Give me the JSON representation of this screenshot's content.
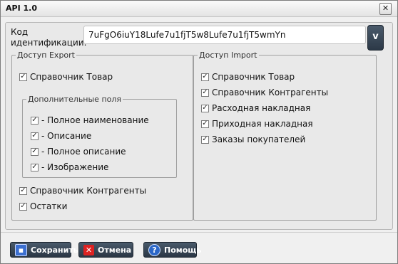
{
  "window": {
    "title": "API 1.0",
    "close_glyph": "✕"
  },
  "code": {
    "label_line1": "Код",
    "label_line2": "идентификации:",
    "value": "7uFgO6iuY18Lufe7u1fjT5w8Lufe7u1fjT5wmYn",
    "dropdown_label": "v"
  },
  "export": {
    "legend": "Доступ Export",
    "items": [
      {
        "label": "Справочник Товар",
        "checked": true
      },
      {
        "label": "Справочник Контрагенты",
        "checked": true
      },
      {
        "label": "Остатки",
        "checked": true
      }
    ],
    "extra": {
      "legend": "Дополнительные поля",
      "items": [
        {
          "label": "- Полное наименование",
          "checked": true
        },
        {
          "label": "- Описание",
          "checked": true
        },
        {
          "label": "- Полное описание",
          "checked": true
        },
        {
          "label": "- Изображение",
          "checked": true
        }
      ]
    }
  },
  "import": {
    "legend": "Доступ Import",
    "items": [
      {
        "label": "Справочник Товар",
        "checked": true
      },
      {
        "label": "Справочник Контрагенты",
        "checked": true
      },
      {
        "label": "Расходная накладная",
        "checked": true
      },
      {
        "label": "Приходная накладная",
        "checked": true
      },
      {
        "label": "Заказы покупателей",
        "checked": true
      }
    ]
  },
  "buttons": {
    "save": {
      "label": "Сохранить",
      "icon": "save-icon"
    },
    "cancel": {
      "label": "Отмена",
      "icon": "cancel-icon",
      "glyph": "✕"
    },
    "help": {
      "label": "Помощь",
      "icon": "help-icon",
      "glyph": "?"
    }
  },
  "check_glyph": "✓"
}
